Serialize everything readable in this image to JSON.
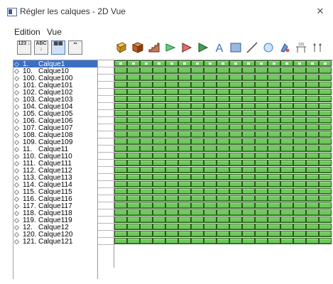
{
  "window": {
    "title": "Régler les calques - 2D Vue",
    "close_glyph": "✕"
  },
  "menu": [
    "Edition",
    "Vue"
  ],
  "toolbar": {
    "toggle_buttons": [
      {
        "name": "sort-by-number-button",
        "label": "123 ↓"
      },
      {
        "name": "sort-by-name-button",
        "label": "ABC ↓"
      },
      {
        "name": "view-grid-a-button",
        "label": "▦▦"
      },
      {
        "name": "view-grid-b-button",
        "label": "▪▪"
      }
    ],
    "tool_icons": [
      "wall-tool-icon",
      "object-tool-icon",
      "stair-tool-icon",
      "dimension-tool-icon",
      "marker-tool-icon",
      "arrow-tool-icon",
      "text-tool-icon",
      "fill-tool-icon",
      "line-tool-icon",
      "circle-tool-icon",
      "paint-tool-icon",
      "level-tool-icon",
      "height-tool-icon"
    ]
  },
  "layers": [
    {
      "num": "1.",
      "name": "Calque1",
      "selected": true
    },
    {
      "num": "10.",
      "name": "Calque10"
    },
    {
      "num": "100.",
      "name": "Calque100"
    },
    {
      "num": "101.",
      "name": "Calque101"
    },
    {
      "num": "102.",
      "name": "Calque102"
    },
    {
      "num": "103.",
      "name": "Calque103"
    },
    {
      "num": "104.",
      "name": "Calque104"
    },
    {
      "num": "105.",
      "name": "Calque105"
    },
    {
      "num": "106.",
      "name": "Calque106"
    },
    {
      "num": "107.",
      "name": "Calque107"
    },
    {
      "num": "108.",
      "name": "Calque108"
    },
    {
      "num": "109.",
      "name": "Calque109"
    },
    {
      "num": "11.",
      "name": "Calque11"
    },
    {
      "num": "110.",
      "name": "Calque110"
    },
    {
      "num": "111.",
      "name": "Calque111"
    },
    {
      "num": "112.",
      "name": "Calque112"
    },
    {
      "num": "113.",
      "name": "Calque113"
    },
    {
      "num": "114.",
      "name": "Calque114"
    },
    {
      "num": "115.",
      "name": "Calque115"
    },
    {
      "num": "116.",
      "name": "Calque116"
    },
    {
      "num": "117.",
      "name": "Calque117"
    },
    {
      "num": "118.",
      "name": "Calque118"
    },
    {
      "num": "119.",
      "name": "Calque119"
    },
    {
      "num": "12.",
      "name": "Calque12"
    },
    {
      "num": "120.",
      "name": "Calque120"
    },
    {
      "num": "121.",
      "name": "Calque121"
    }
  ],
  "grid_columns": 17,
  "colors": {
    "accent": "#3a6fc4",
    "cell": "#6cc95a",
    "cell_border": "#2a5a1a"
  }
}
